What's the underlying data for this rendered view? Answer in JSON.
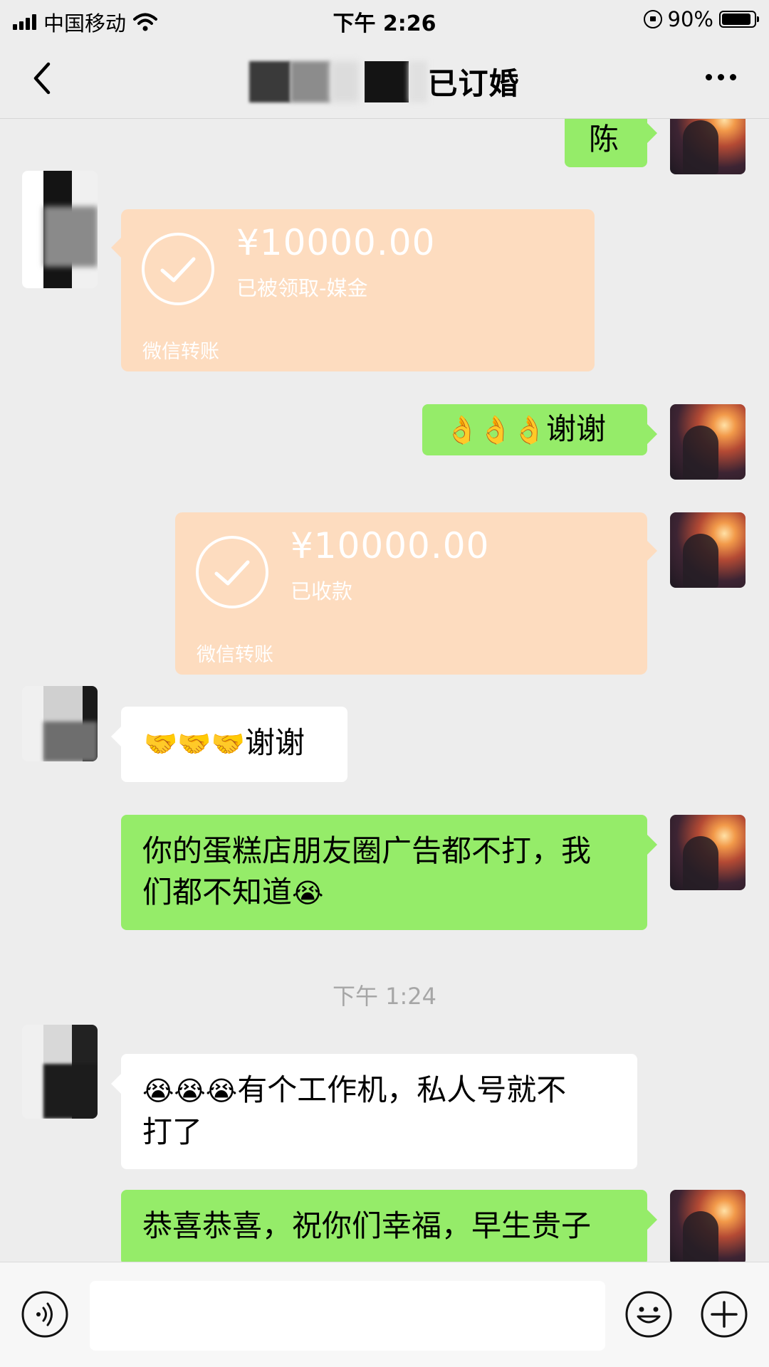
{
  "status_bar": {
    "carrier": "中国移动",
    "time": "下午 2:26",
    "battery_percent": "90%",
    "battery_level": 0.9,
    "icons": [
      "signal-icon",
      "wifi-icon",
      "orientation-lock-icon",
      "battery-icon"
    ]
  },
  "nav": {
    "title_visible_text": "已订婚",
    "back_icon": "chevron-left-icon",
    "more_icon": "more-dots-icon"
  },
  "messages": [
    {
      "side": "right",
      "type": "text",
      "text": "陈"
    },
    {
      "side": "left",
      "type": "transfer",
      "amount": "¥10000.00",
      "status": "已被领取-媒金",
      "label": "微信转账"
    },
    {
      "side": "right",
      "type": "text",
      "emoji": "👌👌👌",
      "text": "谢谢"
    },
    {
      "side": "right",
      "type": "transfer",
      "amount": "¥10000.00",
      "status": "已收款",
      "label": "微信转账"
    },
    {
      "side": "left",
      "type": "text",
      "emoji": "🤝🤝🤝",
      "text": "谢谢"
    },
    {
      "side": "right",
      "type": "text",
      "text_line1": "你的蛋糕店朋友圈广告都不打，我",
      "text_line2": "们都不知道",
      "emoji_tail": "😭"
    },
    {
      "type": "timestamp",
      "text": "下午 1:24"
    },
    {
      "side": "left",
      "type": "text",
      "emoji": "😭😭😭",
      "text_line1": "有个工作机，私人号就不",
      "text_line2": "打了"
    },
    {
      "side": "right",
      "type": "text",
      "text": "恭喜恭喜，祝你们幸福，早生贵子"
    }
  ],
  "input_bar": {
    "icons": [
      "voice-icon",
      "emoji-icon",
      "plus-icon"
    ]
  },
  "colors": {
    "background": "#ededed",
    "bubble_green": "#95ec69",
    "bubble_white": "#ffffff",
    "transfer_received": "#fddcbf"
  }
}
